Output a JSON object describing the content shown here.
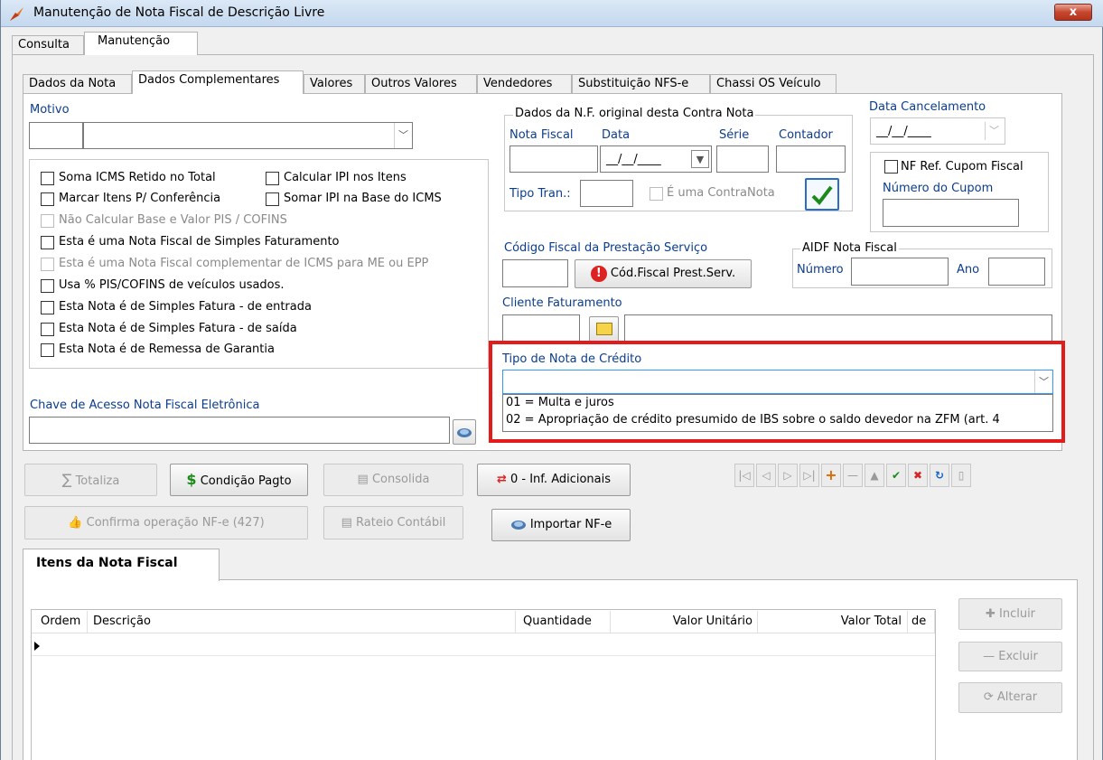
{
  "window": {
    "title": "Manutenção de Nota Fiscal de Descrição Livre",
    "close_label": "x"
  },
  "main_tabs": [
    "Consulta",
    "Manutenção"
  ],
  "sub_tabs": [
    "Dados da Nota",
    "Dados Complementares",
    "Valores",
    "Outros Valores",
    "Vendedores",
    "Substituição NFS-e",
    "Chassi OS Veículo"
  ],
  "motivo": {
    "label": "Motivo"
  },
  "checkboxes": {
    "soma_icms": "Soma ICMS Retido no Total",
    "calcular_ipi": "Calcular IPI nos Itens",
    "marcar_itens": "Marcar Itens P/ Conferência",
    "somar_ipi": "Somar IPI na Base do ICMS",
    "nao_calcular_pis": "Não Calcular Base e Valor PIS / COFINS",
    "simples_faturamento": "Esta é uma Nota Fiscal de Simples Faturamento",
    "complementar_icms": "Esta é uma Nota Fiscal complementar de ICMS para ME ou EPP",
    "usa_pis": "Usa % PIS/COFINS de veículos usados.",
    "fatura_entrada": "Esta Nota é de Simples Fatura - de entrada",
    "fatura_saida": "Esta Nota é de Simples Fatura - de saída",
    "remessa_garantia": "Esta Nota é de Remessa de Garantia"
  },
  "chave": {
    "label": "Chave de Acesso Nota Fiscal Eletrônica"
  },
  "nf_original": {
    "legend": "Dados da N.F. original desta Contra Nota",
    "nota_fiscal": "Nota Fiscal",
    "data": "Data",
    "serie": "Série",
    "contador": "Contador",
    "date_value": "__/__/____",
    "tipo_tran": "Tipo Tran.:",
    "contranota": "É uma ContraNota"
  },
  "cancelamento": {
    "label": "Data Cancelamento",
    "date_value": "__/__/____"
  },
  "cupom": {
    "label": "NF Ref. Cupom Fiscal",
    "numero_label": "Número do Cupom"
  },
  "codigo_fiscal": {
    "label": "Código Fiscal da Prestação Serviço",
    "button": "Cód.Fiscal Prest.Serv."
  },
  "aidf": {
    "legend": "AIDF Nota Fiscal",
    "numero": "Número",
    "ano": "Ano"
  },
  "cliente": {
    "label": "Cliente Faturamento"
  },
  "tipo_credito": {
    "label": "Tipo de Nota de Crédito",
    "value": "",
    "options": [
      "01 = Multa e juros",
      "02 = Apropriação de crédito presumido de IBS sobre o saldo devedor na ZFM (art. 4"
    ]
  },
  "actions": {
    "totaliza": "Totaliza",
    "condicao": "Condição Pagto",
    "consolida": "Consolida",
    "inf_adicionais": "0 - Inf. Adicionais",
    "confirma": "Confirma operação NF-e (427)",
    "rateio": "Rateio Contábil",
    "importar": "Importar NF-e"
  },
  "itens": {
    "tab": "Itens da Nota Fiscal",
    "columns": [
      "Ordem",
      "Descrição",
      "Quantidade",
      "Valor Unitário",
      "Valor Total",
      "de"
    ],
    "incluir": "Incluir",
    "excluir": "Excluir",
    "alterar": "Alterar"
  },
  "colors": {
    "highlight": "#e31b1b",
    "accent_blue": "#0b3d8c",
    "selection": "#3399ff"
  }
}
